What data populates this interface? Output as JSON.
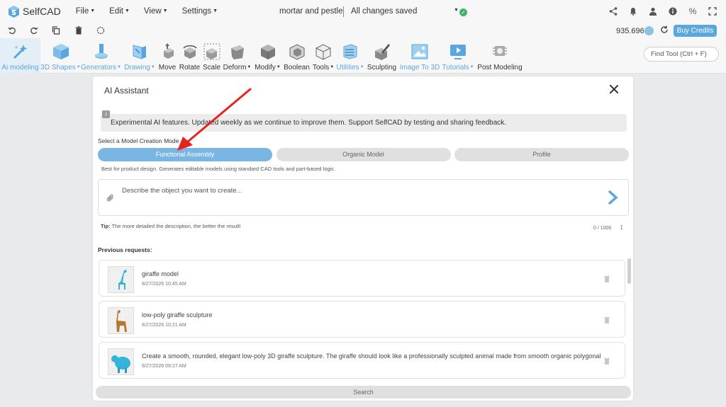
{
  "app": {
    "name": "SelfCAD"
  },
  "menu": [
    {
      "label": "File"
    },
    {
      "label": "Edit"
    },
    {
      "label": "View"
    },
    {
      "label": "Settings"
    }
  ],
  "document": {
    "title": "mortar and pestle",
    "status": "All changes saved"
  },
  "credits": {
    "amount": "935.696",
    "buy_label": "Buy Credits"
  },
  "toolbar": {
    "tools": [
      {
        "label": "Ai modeling",
        "icon": "ai-modeling-icon",
        "active": true,
        "dropdown": false
      },
      {
        "label": "3D Shapes",
        "icon": "cube-icon",
        "dropdown": true
      },
      {
        "label": "Generators",
        "icon": "generators-icon",
        "dropdown": true
      },
      {
        "label": "Drawing",
        "icon": "drawing-icon",
        "dropdown": true
      },
      {
        "label": "Move",
        "icon": "move-icon",
        "dropdown": false
      },
      {
        "label": "Rotate",
        "icon": "rotate-icon",
        "dropdown": false
      },
      {
        "label": "Scale",
        "icon": "scale-icon",
        "dropdown": false
      },
      {
        "label": "Deform",
        "icon": "deform-icon",
        "dropdown": true
      },
      {
        "label": "Modify",
        "icon": "modify-icon",
        "dropdown": true
      },
      {
        "label": "Boolean",
        "icon": "boolean-icon",
        "dropdown": false
      },
      {
        "label": "Tools",
        "icon": "tools-icon",
        "dropdown": true
      },
      {
        "label": "Utilities",
        "icon": "utilities-icon",
        "dropdown": true
      },
      {
        "label": "Sculpting",
        "icon": "sculpting-icon",
        "dropdown": false
      },
      {
        "label": "Image To 3D",
        "icon": "image-to-3d-icon",
        "dropdown": false
      },
      {
        "label": "Tutorials",
        "icon": "tutorials-icon",
        "dropdown": true
      },
      {
        "label": "Post Modeling",
        "icon": "post-modeling-icon",
        "dropdown": false
      }
    ],
    "find_placeholder": "Find Tool (Ctrl + F)"
  },
  "assistant": {
    "title": "AI Assistant",
    "notice": "Experimental AI features. Updated weekly as we continue to improve them. Support SelfCAD by testing and sharing feedback.",
    "mode_label": "Select a Model Creation Mode",
    "modes": [
      {
        "label": "Functional Assembly",
        "active": true
      },
      {
        "label": "Organic Model",
        "active": false
      },
      {
        "label": "Profile",
        "active": false
      }
    ],
    "mode_description": "Best for product design. Generates editable models using standard CAD tools and part-based logic.",
    "prompt_placeholder": "Describe the object you want to create...",
    "tip_prefix": "Tip:",
    "tip_text": "The more detailed the description, the better the result!",
    "counter": "0 / 1000",
    "previous_label": "Previous requests:",
    "requests": [
      {
        "title": "giraffe model",
        "time": "8/27/2026 10:45 AM"
      },
      {
        "title": "low-poly giraffe sculpture",
        "time": "8/27/2026 10:21 AM"
      },
      {
        "title": "Create a smooth, rounded, elegant low-poly 3D giraffe sculpture. The giraffe should look like a professionally sculpted animal made from smooth organic polygonal s...",
        "time": "8/27/2026 09:27 AM"
      }
    ],
    "search_label": "Search"
  },
  "colors": {
    "accent": "#5aa7de",
    "active_mode": "#79b6e3",
    "annotation_arrow": "#e8231f"
  }
}
